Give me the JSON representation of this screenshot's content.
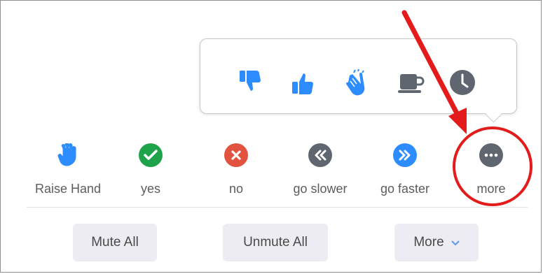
{
  "reactions": {
    "items": [
      {
        "name": "thumbs-down"
      },
      {
        "name": "thumbs-up"
      },
      {
        "name": "clap"
      },
      {
        "name": "coffee"
      },
      {
        "name": "clock"
      }
    ]
  },
  "feedback": {
    "items": [
      {
        "label": "Raise Hand",
        "icon": "raise-hand-icon"
      },
      {
        "label": "yes",
        "icon": "check-icon"
      },
      {
        "label": "no",
        "icon": "x-icon"
      },
      {
        "label": "go slower",
        "icon": "rewind-icon"
      },
      {
        "label": "go faster",
        "icon": "fast-forward-icon"
      },
      {
        "label": "more",
        "icon": "ellipsis-icon"
      }
    ]
  },
  "buttons": {
    "mute_all": "Mute All",
    "unmute_all": "Unmute All",
    "more": "More"
  },
  "colors": {
    "blue": "#2d8cff",
    "green": "#1fa34a",
    "red": "#e1533f",
    "gray": "#5f6670",
    "annotation": "#e41b1b"
  }
}
